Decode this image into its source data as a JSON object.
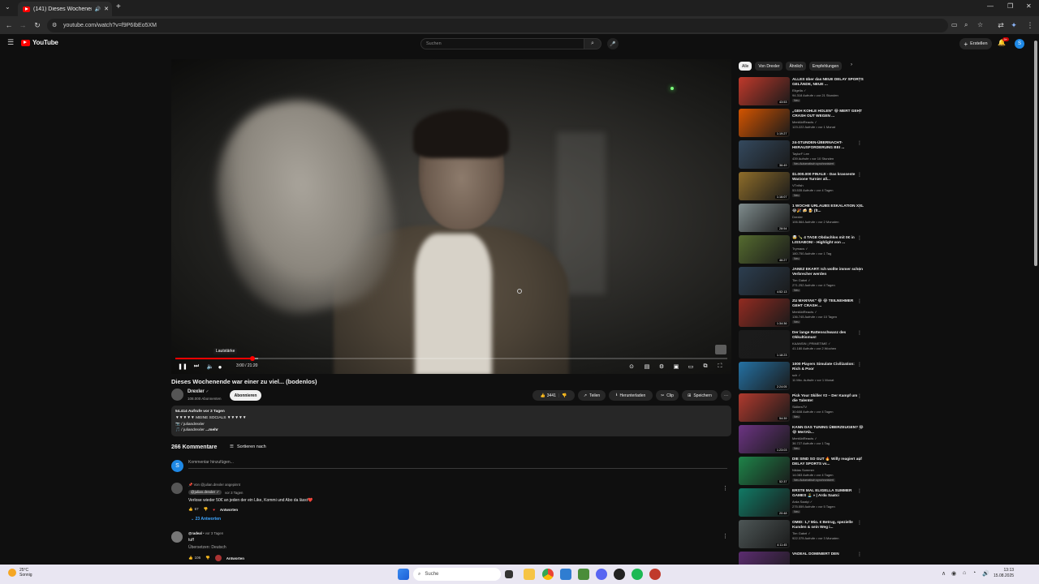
{
  "browser": {
    "tab_title": "(141) Dieses Wochenende ...",
    "url": "youtube.com/watch?v=f9P6IbEo5XM",
    "new_tab": "+"
  },
  "header": {
    "logo_text": "YouTube",
    "search_placeholder": "Suchen",
    "create_label": "Erstellen",
    "bell_badge": "9+",
    "avatar_letter": "S"
  },
  "player": {
    "volume_tooltip": "Lautstärke",
    "time_current": "3:00",
    "time_total": "21:20",
    "progress": 0.14,
    "buffered": 0.15
  },
  "video": {
    "title": "Dieses Wochenende war einer zu viel... (bodenlos)",
    "channel": "Drexler",
    "subscribers": "108.000 Abonnenten",
    "subscribe_label": "Abonnieren",
    "likes": "3441",
    "share": "Teilen",
    "download": "Herunterladen",
    "clip": "Clip",
    "save": "Speichern",
    "more": "···"
  },
  "description": {
    "stats": "54.414 Aufrufe  vor 3 Tagen",
    "line1": "▼▼▼▼▼ MEINE SOCIALS ▼▼▼▼▼",
    "line2": "📷 / juliandrexler",
    "line3": "🎵 / juliandrexler",
    "more": "...mehr"
  },
  "comments": {
    "count": "266 Kommentare",
    "sort": "Sortieren nach",
    "input_placeholder": "Kommentar hinzufügen...",
    "my_avatar": "S",
    "pinned_by": "📌 Von @julian.drexler angepinnt",
    "c1_author": "@julian.drexler ✓",
    "c1_time": "vor 3 Tagen",
    "c1_text": "Verlose wieder 50€ an jeden der ein Like, Kommi und Abo da lässt❤️",
    "c1_likes": "67",
    "c1_reply": "Antworten",
    "c1_replies": "⌄  23 Antworten",
    "c2_author": "@radeal",
    "c2_time": "vor 3 Tagen",
    "c2_text": "tuff",
    "c2_translate": "Übersetzen: Deutsch",
    "c2_likes": "106",
    "c2_reply": "Antworten"
  },
  "chips": [
    "Alle",
    "Von Drexler",
    "Ähnlich",
    "Empfehlungen"
  ],
  "recommendations": [
    {
      "title": "ALLES über das NEUE DELAY SPORTS GELÄNDE, NEUE ...",
      "channel": "Eligella ✓",
      "meta": "94.318 Aufrufe • vor 21 Stunden",
      "badge": "Neu",
      "duration": "43:53",
      "color": "#c0392b"
    },
    {
      "title": "„GEH KOHLE HOLEN\" 😂 MERT GEHT CRASH OUT WEGEN ...",
      "channel": "MertAbiReacts ✓",
      "meta": "123.222 Aufrufe • vor 1 Monat",
      "badge": "",
      "duration": "1:19:27",
      "color": "#d35400"
    },
    {
      "title": "24-STUNDEN-ÜBERNACHT-HERAUSFORDERUNG BEI ...",
      "channel": "TaylorF Lee",
      "meta": "439 Aufrufe • vor 10 Stunden",
      "badge": "Neu   Automatisch synchronisiert",
      "duration": "36:49",
      "color": "#34495e"
    },
    {
      "title": "$1.000.000 FINALE - Das krasseste Warzone Turnier all...",
      "channel": "VTnfish",
      "meta": "53.535 Aufrufe • vor 4 Tagen",
      "badge": "Neu",
      "duration": "1:16:07",
      "color": "#8e6d2a"
    },
    {
      "title": "1 WOCHE URLAUBS ESKALATION XXL 😂🎉 🍻 🍺 (ft...",
      "channel": "Drexler",
      "meta": "106.564 Aufrufe • vor 2 Monaten",
      "badge": "",
      "duration": "28:54",
      "color": "#7f8c8d"
    },
    {
      "title": "🤯 🍾 4 TAGE Obdachlos mit 0€ in LISSABON! - Highlight von ...",
      "channel": "Trymacs ✓",
      "meta": "180.750 Aufrufe • vor 1 Tag",
      "badge": "Neu",
      "duration": "46:27",
      "color": "#556b2f"
    },
    {
      "title": "JANEZ EKART: Ich wollte immer schon Verbrecher werden",
      "channel": "Tim Gabel ✓",
      "meta": "271.252 Aufrufe • vor 4 Tagen",
      "badge": "Neu",
      "duration": "4:52:13",
      "color": "#2c3e50"
    },
    {
      "title": "ZU MANYAK\" 😂 😂 TEILNEHMER GEHT CRASH ...",
      "channel": "MertAbiReacts ✓",
      "meta": "136.745 Aufrufe • vor 10 Tagen",
      "badge": "Neu",
      "duration": "1:34:36",
      "color": "#922b21"
    },
    {
      "title": "Der lange Rattenschwanz des Okkultismus!",
      "channel": "KAANSIN | PRIMETIME ✓",
      "meta": "41.180 Aufrufe • vor 2 Wochen",
      "badge": "",
      "duration": "1:18:23",
      "color": "#1b1b1b"
    },
    {
      "title": "1000 Players Simulate Civilization: Rich & Poor",
      "channel": "sch ✓",
      "meta": "11 Mio. Aufrufe • vor 1 Monat",
      "badge": "",
      "duration": "2:24:05",
      "color": "#2471a3"
    },
    {
      "title": "Pick Your Skiller #2 – Der Kampf um die Talente!",
      "channel": "SkillersTV",
      "meta": "30.608 Aufrufe • vor 4 Tagen",
      "badge": "Neu",
      "duration": "54:39",
      "color": "#b03a2e"
    },
    {
      "title": "KANN DAS TUNING ÜBERZEUGEN? 😂 😂 MertAb...",
      "channel": "MertAbiReacts ✓",
      "meta": "36.727 Aufrufe • vor 1 Tag",
      "badge": "Neu",
      "duration": "1:23:03",
      "color": "#6c3483"
    },
    {
      "title": "DIE SIND SO GUT 🔥 Willy reagiert auf DELAY SPORTS vs...",
      "channel": "Niklas Sommer",
      "meta": "14.083 Aufrufe • vor 4 Tagen",
      "badge": "Neu   Automatisch synchronisiert",
      "duration": "52:37",
      "color": "#1e8449"
    },
    {
      "title": "ERSTE MAL ELIGELLA SUMMER GAMES 🏝️ » | Arda Saatci",
      "channel": "Arda Saatçi ✓",
      "meta": "275.559 Aufrufe • vor 5 Tagen",
      "badge": "Neu",
      "duration": "20:48",
      "color": "#117a65"
    },
    {
      "title": "OMID: 1,7 Mio. € Betrug, spezielle Kunden & sein Weg i...",
      "channel": "Tim Gabel ✓",
      "meta": "922.375 Aufrufe • vor 3 Monaten",
      "badge": "",
      "duration": "4:11:45",
      "color": "#4d5656"
    },
    {
      "title": "VADEAL DOMINIERT DEN",
      "channel": "",
      "meta": "",
      "badge": "",
      "duration": "",
      "color": "#5b2c6f"
    }
  ],
  "taskbar": {
    "temp": "25°C",
    "weather": "Sonnig",
    "search": "Suche",
    "time": "13:13",
    "date": "15.08.2025"
  }
}
